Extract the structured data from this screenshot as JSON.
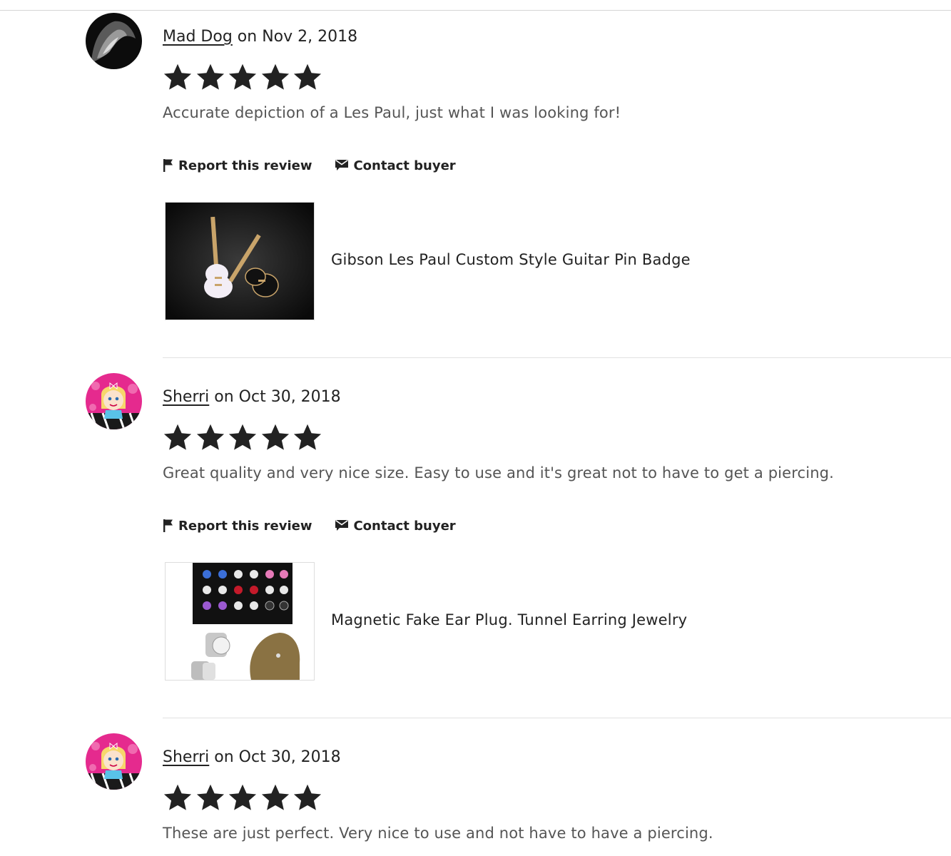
{
  "reviews": [
    {
      "reviewer": "Mad Dog",
      "date_text": "on Nov 2, 2018",
      "rating": 5,
      "text": "Accurate depiction of a Les Paul, just what I was looking for!",
      "report_label": "Report this review",
      "contact_label": "Contact buyer",
      "item_title": "Gibson Les Paul Custom Style Guitar Pin Badge"
    },
    {
      "reviewer": "Sherri",
      "date_text": "on Oct 30, 2018",
      "rating": 5,
      "text": "Great quality and very nice size. Easy to use and it's great not to have to get a piercing.",
      "report_label": "Report this review",
      "contact_label": "Contact buyer",
      "item_title": "Magnetic Fake Ear Plug. Tunnel Earring Jewelry"
    },
    {
      "reviewer": "Sherri",
      "date_text": "on Oct 30, 2018",
      "rating": 5,
      "text": "These are just perfect. Very nice to use and not have to have a piercing."
    }
  ],
  "icons": {
    "star": "star-icon",
    "report": "flag-icon",
    "contact": "envelope-icon"
  },
  "colors": {
    "text": "#222222",
    "muted": "#555555",
    "divider": "#e1e1e1"
  }
}
